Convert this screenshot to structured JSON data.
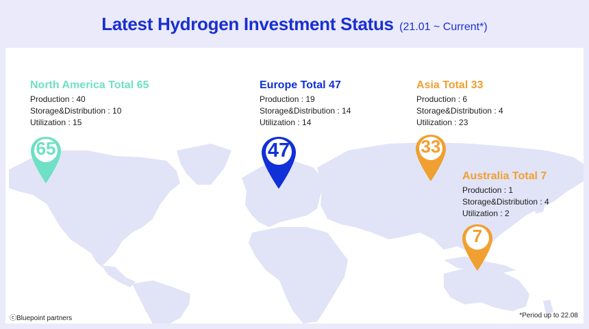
{
  "header": {
    "title": "Latest Hydrogen Investment Status",
    "subtitle": "(21.01 ~ Current*)"
  },
  "colors": {
    "north_america": "#6ee0c5",
    "europe": "#1030d8",
    "asia": "#f0a030",
    "australia": "#f0a030",
    "land": "#e1e3f7"
  },
  "regions": {
    "north_america": {
      "heading": "North America Total 65",
      "production": "Production : 40",
      "storage": "Storage&Distribution : 10",
      "utilization": "Utilization : 15",
      "pin_value": "65"
    },
    "europe": {
      "heading": "Europe Total 47",
      "production": "Production : 19",
      "storage": "Storage&Distribution : 14",
      "utilization": "Utilization : 14",
      "pin_value": "47"
    },
    "asia": {
      "heading": "Asia Total 33",
      "production": "Production : 6",
      "storage": "Storage&Distribution : 4",
      "utilization": "Utilization : 23",
      "pin_value": "33"
    },
    "australia": {
      "heading": "Australia Total 7",
      "production": "Production : 1",
      "storage": "Storage&Distribution : 4",
      "utilization": "Utilization : 2",
      "pin_value": "7"
    }
  },
  "footer": {
    "credit": "ⓒBluepoint partners",
    "note": "*Period up to 22.08"
  }
}
